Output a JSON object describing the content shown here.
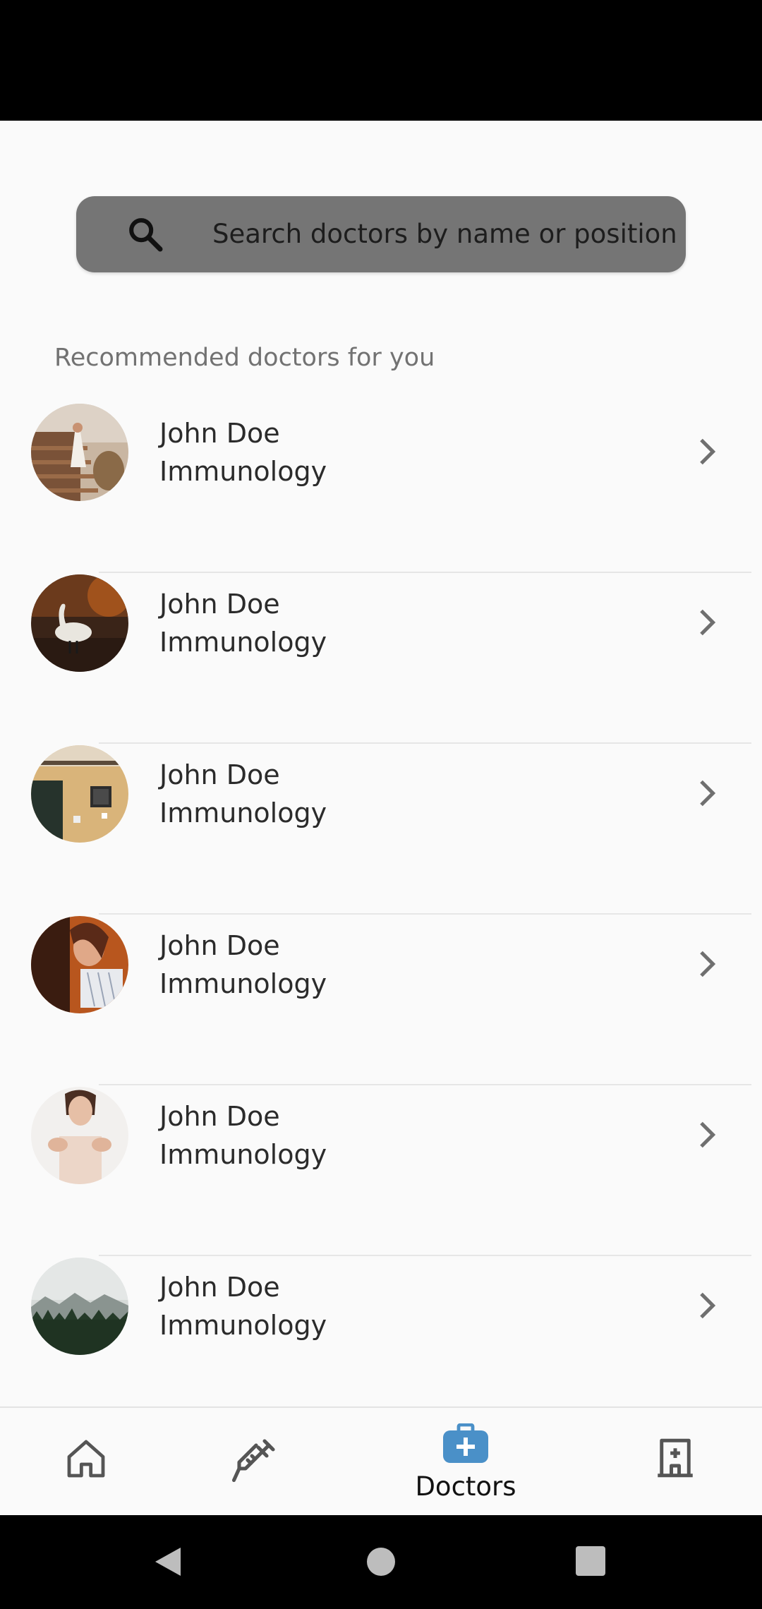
{
  "search": {
    "placeholder": "Search doctors by name or position"
  },
  "section_title": "Recommended doctors for you",
  "doctors": [
    {
      "name": "John Doe",
      "specialty": "Immunology",
      "avatar": "woman-on-stairs-photo"
    },
    {
      "name": "John Doe",
      "specialty": "Immunology",
      "avatar": "swan-photo"
    },
    {
      "name": "John Doe",
      "specialty": "Immunology",
      "avatar": "building-facade-photo"
    },
    {
      "name": "John Doe",
      "specialty": "Immunology",
      "avatar": "woman-portrait-photo"
    },
    {
      "name": "John Doe",
      "specialty": "Immunology",
      "avatar": "woman-hands-photo"
    },
    {
      "name": "John Doe",
      "specialty": "Immunology",
      "avatar": "misty-forest-photo"
    }
  ],
  "bottom_nav": {
    "items": [
      {
        "icon": "home-icon",
        "label": ""
      },
      {
        "icon": "syringe-icon",
        "label": ""
      },
      {
        "icon": "medical-bag-icon",
        "label": "Doctors",
        "active": true
      },
      {
        "icon": "hospital-icon",
        "label": ""
      }
    ]
  },
  "colors": {
    "accent": "#4a90c8",
    "search_bg": "#757575",
    "background": "#fafafa"
  }
}
